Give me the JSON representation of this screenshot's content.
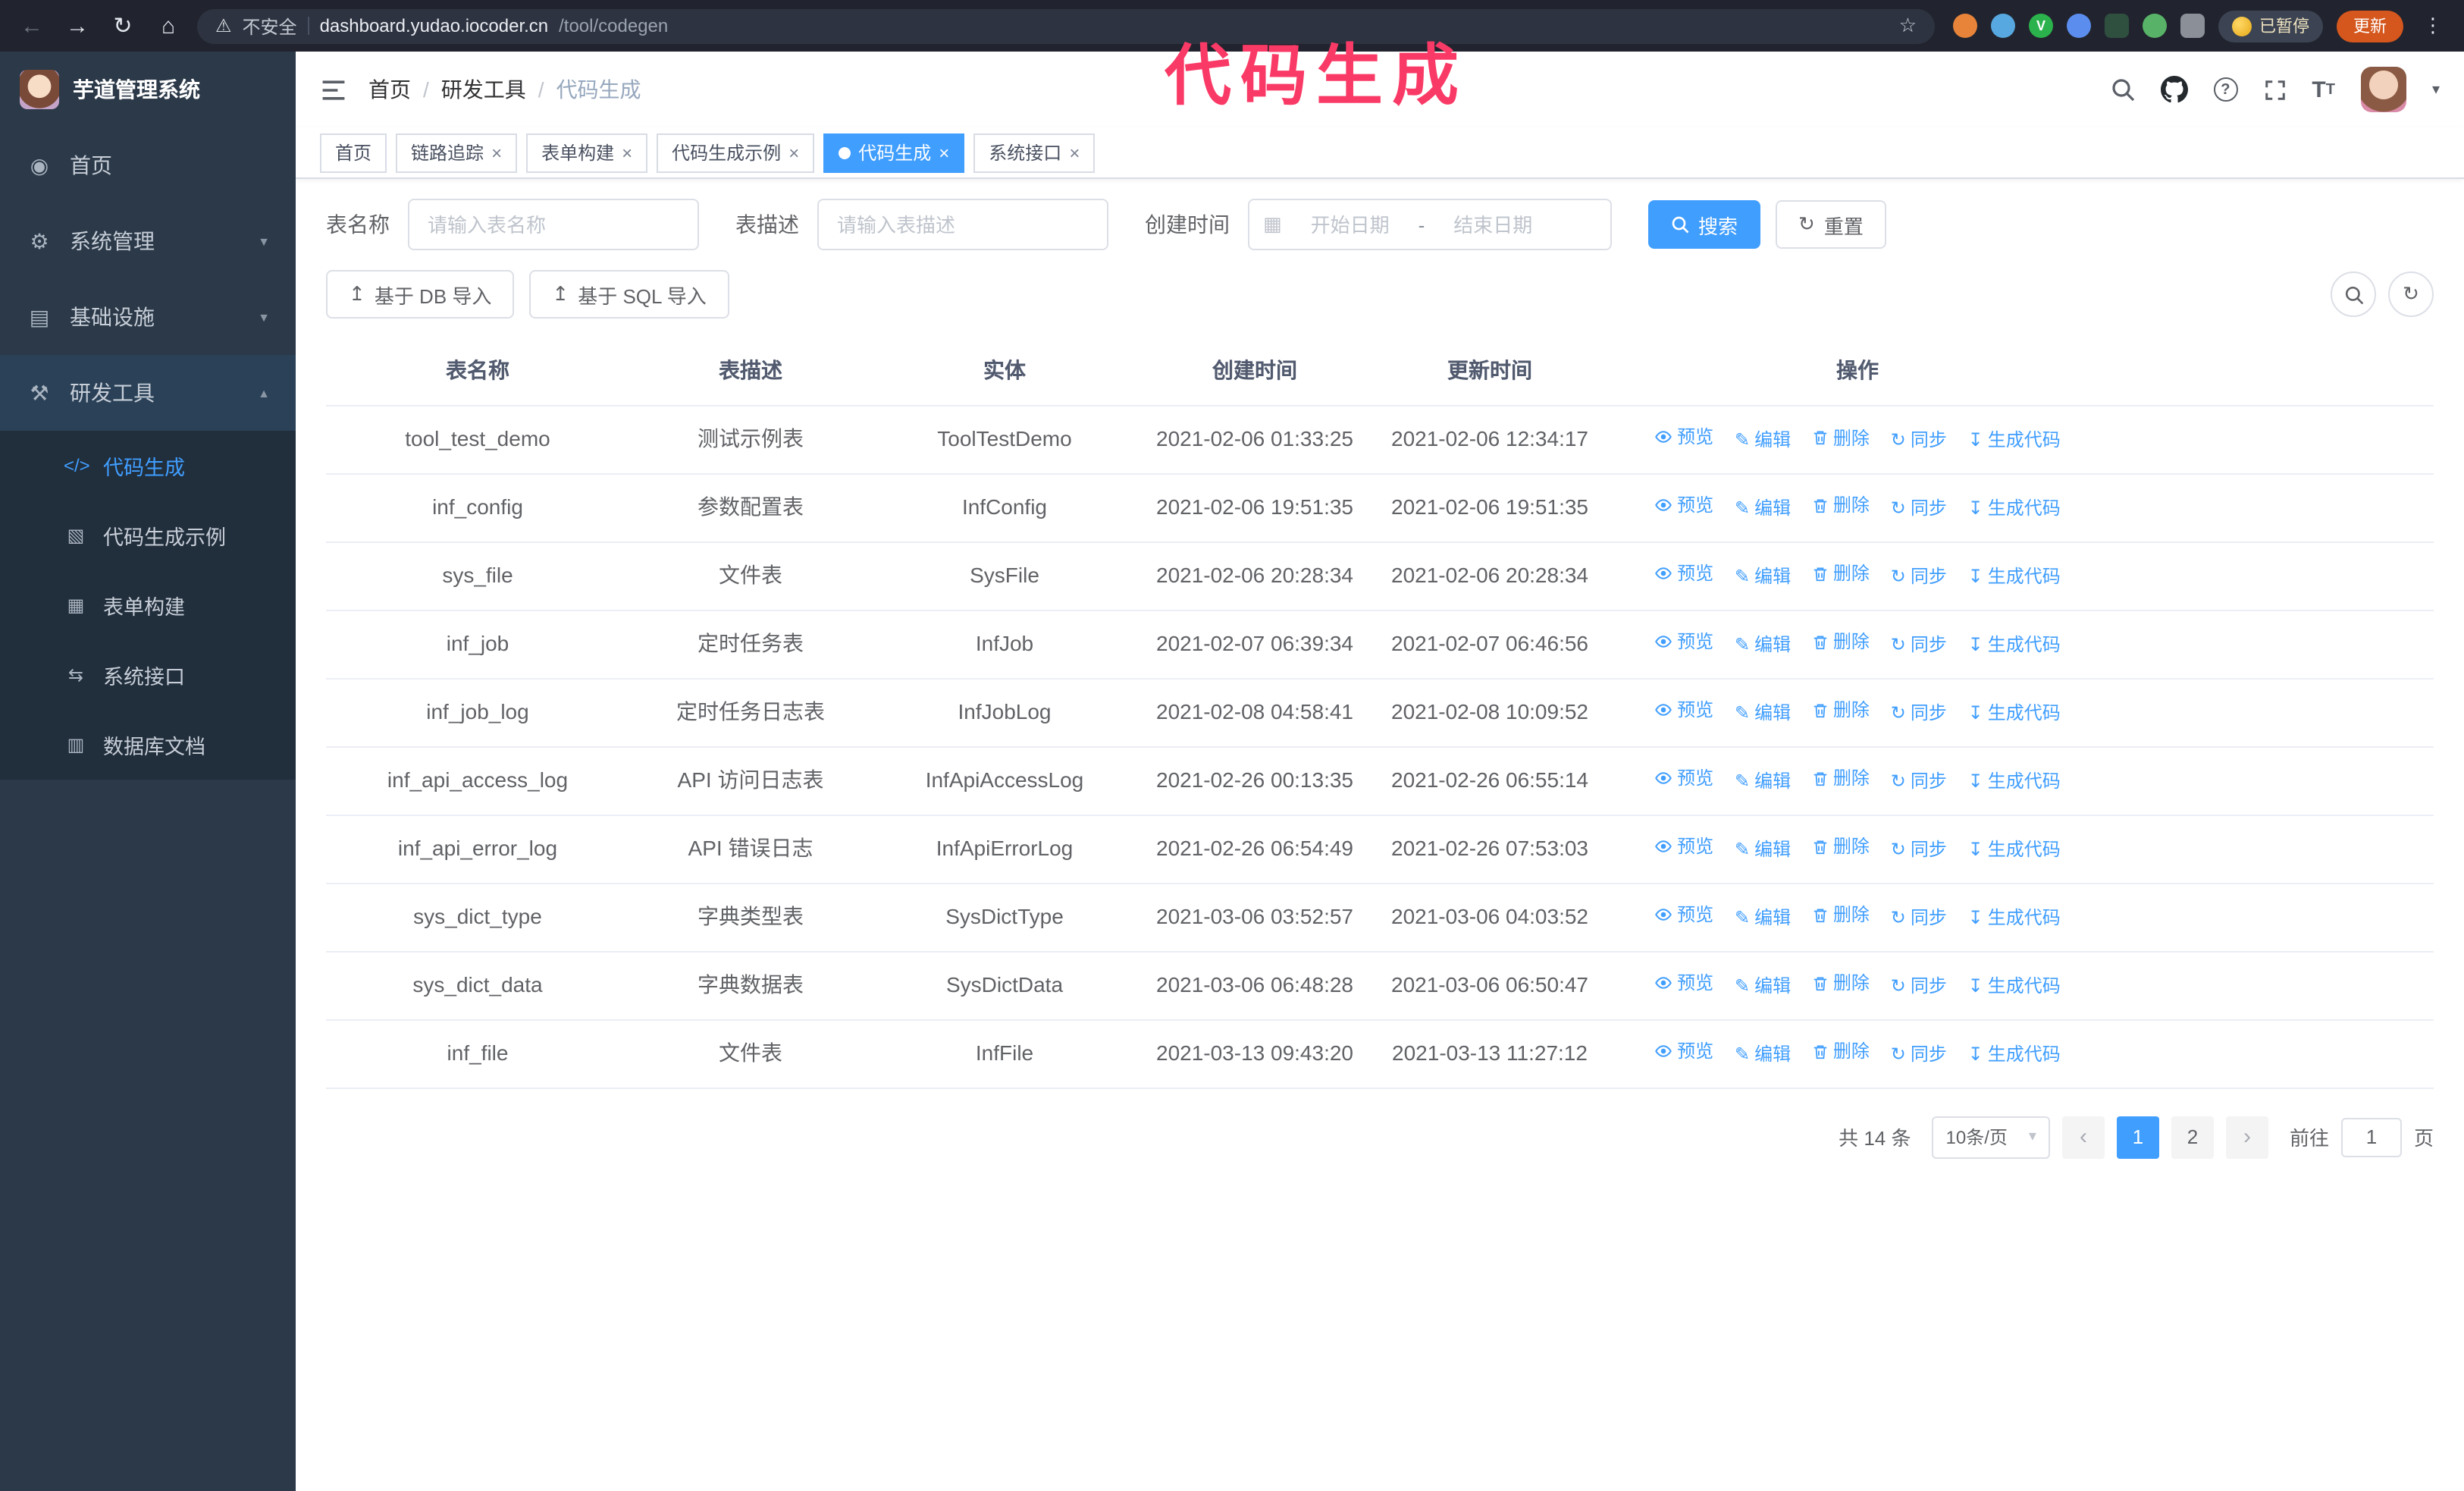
{
  "colors": {
    "accent": "#409eff",
    "annotation": "#fa3a66",
    "sidebar_bg": "#2b3948",
    "chrome_bg": "#21242e",
    "active_tab_bg": "#409eff"
  },
  "icons": {
    "back": "←",
    "forward": "→",
    "reload": "↻",
    "home": "⌂",
    "warning": "⚠",
    "star": "☆",
    "more": "⋮",
    "dashboard": "◉",
    "gear": "⚙",
    "monitor": "▤",
    "tools": "⚒",
    "chevron_down": "▼",
    "chevron_up": "▲",
    "code": "</>",
    "shield": "▧",
    "form": "▦",
    "api": "⇆",
    "database": "▥",
    "close": "×",
    "caret": "▾",
    "question": "?",
    "font_size": "T",
    "calendar": "▦",
    "upload": "↥",
    "edit": "✎",
    "sync": "↻",
    "download": "↧",
    "refresh": "↻",
    "prev": "‹",
    "next": "›"
  },
  "browser": {
    "security_label": "不安全",
    "url_host": "dashboard.yudao.iocoder.cn",
    "url_path": "/tool/codegen",
    "paused_badge": "已暂停",
    "update_button": "更新"
  },
  "annotation": "代码生成",
  "sidebar": {
    "logo_title": "芋道管理系统",
    "menu": [
      {
        "label": "首页"
      },
      {
        "label": "系统管理"
      },
      {
        "label": "基础设施"
      },
      {
        "label": "研发工具"
      }
    ],
    "submenu": [
      {
        "label": "代码生成"
      },
      {
        "label": "代码生成示例"
      },
      {
        "label": "表单构建"
      },
      {
        "label": "系统接口"
      },
      {
        "label": "数据库文档"
      }
    ]
  },
  "header": {
    "breadcrumb": [
      "首页",
      "研发工具",
      "代码生成"
    ],
    "separator": "/"
  },
  "tabs": [
    {
      "label": "首页"
    },
    {
      "label": "链路追踪"
    },
    {
      "label": "表单构建"
    },
    {
      "label": "代码生成示例"
    },
    {
      "label": "代码生成"
    },
    {
      "label": "系统接口"
    }
  ],
  "filters": {
    "table_name_label": "表名称",
    "table_name_placeholder": "请输入表名称",
    "table_desc_label": "表描述",
    "table_desc_placeholder": "请输入表描述",
    "create_time_label": "创建时间",
    "date_start_placeholder": "开始日期",
    "date_separator": "-",
    "date_end_placeholder": "结束日期",
    "search_button": "搜索",
    "reset_button": "重置"
  },
  "toolbar": {
    "import_db_button": "基于 DB 导入",
    "import_sql_button": "基于 SQL 导入"
  },
  "table": {
    "columns": [
      "表名称",
      "表描述",
      "实体",
      "创建时间",
      "更新时间",
      "操作"
    ],
    "row_actions": [
      "预览",
      "编辑",
      "删除",
      "同步",
      "生成代码"
    ],
    "rows": [
      {
        "name": "tool_test_demo",
        "desc": "测试示例表",
        "entity": "ToolTestDemo",
        "created": "2021-02-06 01:33:25",
        "updated": "2021-02-06 12:34:17"
      },
      {
        "name": "inf_config",
        "desc": "参数配置表",
        "entity": "InfConfig",
        "created": "2021-02-06 19:51:35",
        "updated": "2021-02-06 19:51:35"
      },
      {
        "name": "sys_file",
        "desc": "文件表",
        "entity": "SysFile",
        "created": "2021-02-06 20:28:34",
        "updated": "2021-02-06 20:28:34"
      },
      {
        "name": "inf_job",
        "desc": "定时任务表",
        "entity": "InfJob",
        "created": "2021-02-07 06:39:34",
        "updated": "2021-02-07 06:46:56"
      },
      {
        "name": "inf_job_log",
        "desc": "定时任务日志表",
        "entity": "InfJobLog",
        "created": "2021-02-08 04:58:41",
        "updated": "2021-02-08 10:09:52"
      },
      {
        "name": "inf_api_access_log",
        "desc": "API 访问日志表",
        "entity": "InfApiAccessLog",
        "created": "2021-02-26 00:13:35",
        "updated": "2021-02-26 06:55:14"
      },
      {
        "name": "inf_api_error_log",
        "desc": "API 错误日志",
        "entity": "InfApiErrorLog",
        "created": "2021-02-26 06:54:49",
        "updated": "2021-02-26 07:53:03"
      },
      {
        "name": "sys_dict_type",
        "desc": "字典类型表",
        "entity": "SysDictType",
        "created": "2021-03-06 03:52:57",
        "updated": "2021-03-06 04:03:52"
      },
      {
        "name": "sys_dict_data",
        "desc": "字典数据表",
        "entity": "SysDictData",
        "created": "2021-03-06 06:48:28",
        "updated": "2021-03-06 06:50:47"
      },
      {
        "name": "inf_file",
        "desc": "文件表",
        "entity": "InfFile",
        "created": "2021-03-13 09:43:20",
        "updated": "2021-03-13 11:27:12"
      }
    ]
  },
  "pagination": {
    "total_text": "共 14 条",
    "page_size": "10条/页",
    "pages": [
      "1",
      "2"
    ],
    "goto_label": "前往",
    "goto_value": "1",
    "goto_unit": "页"
  }
}
